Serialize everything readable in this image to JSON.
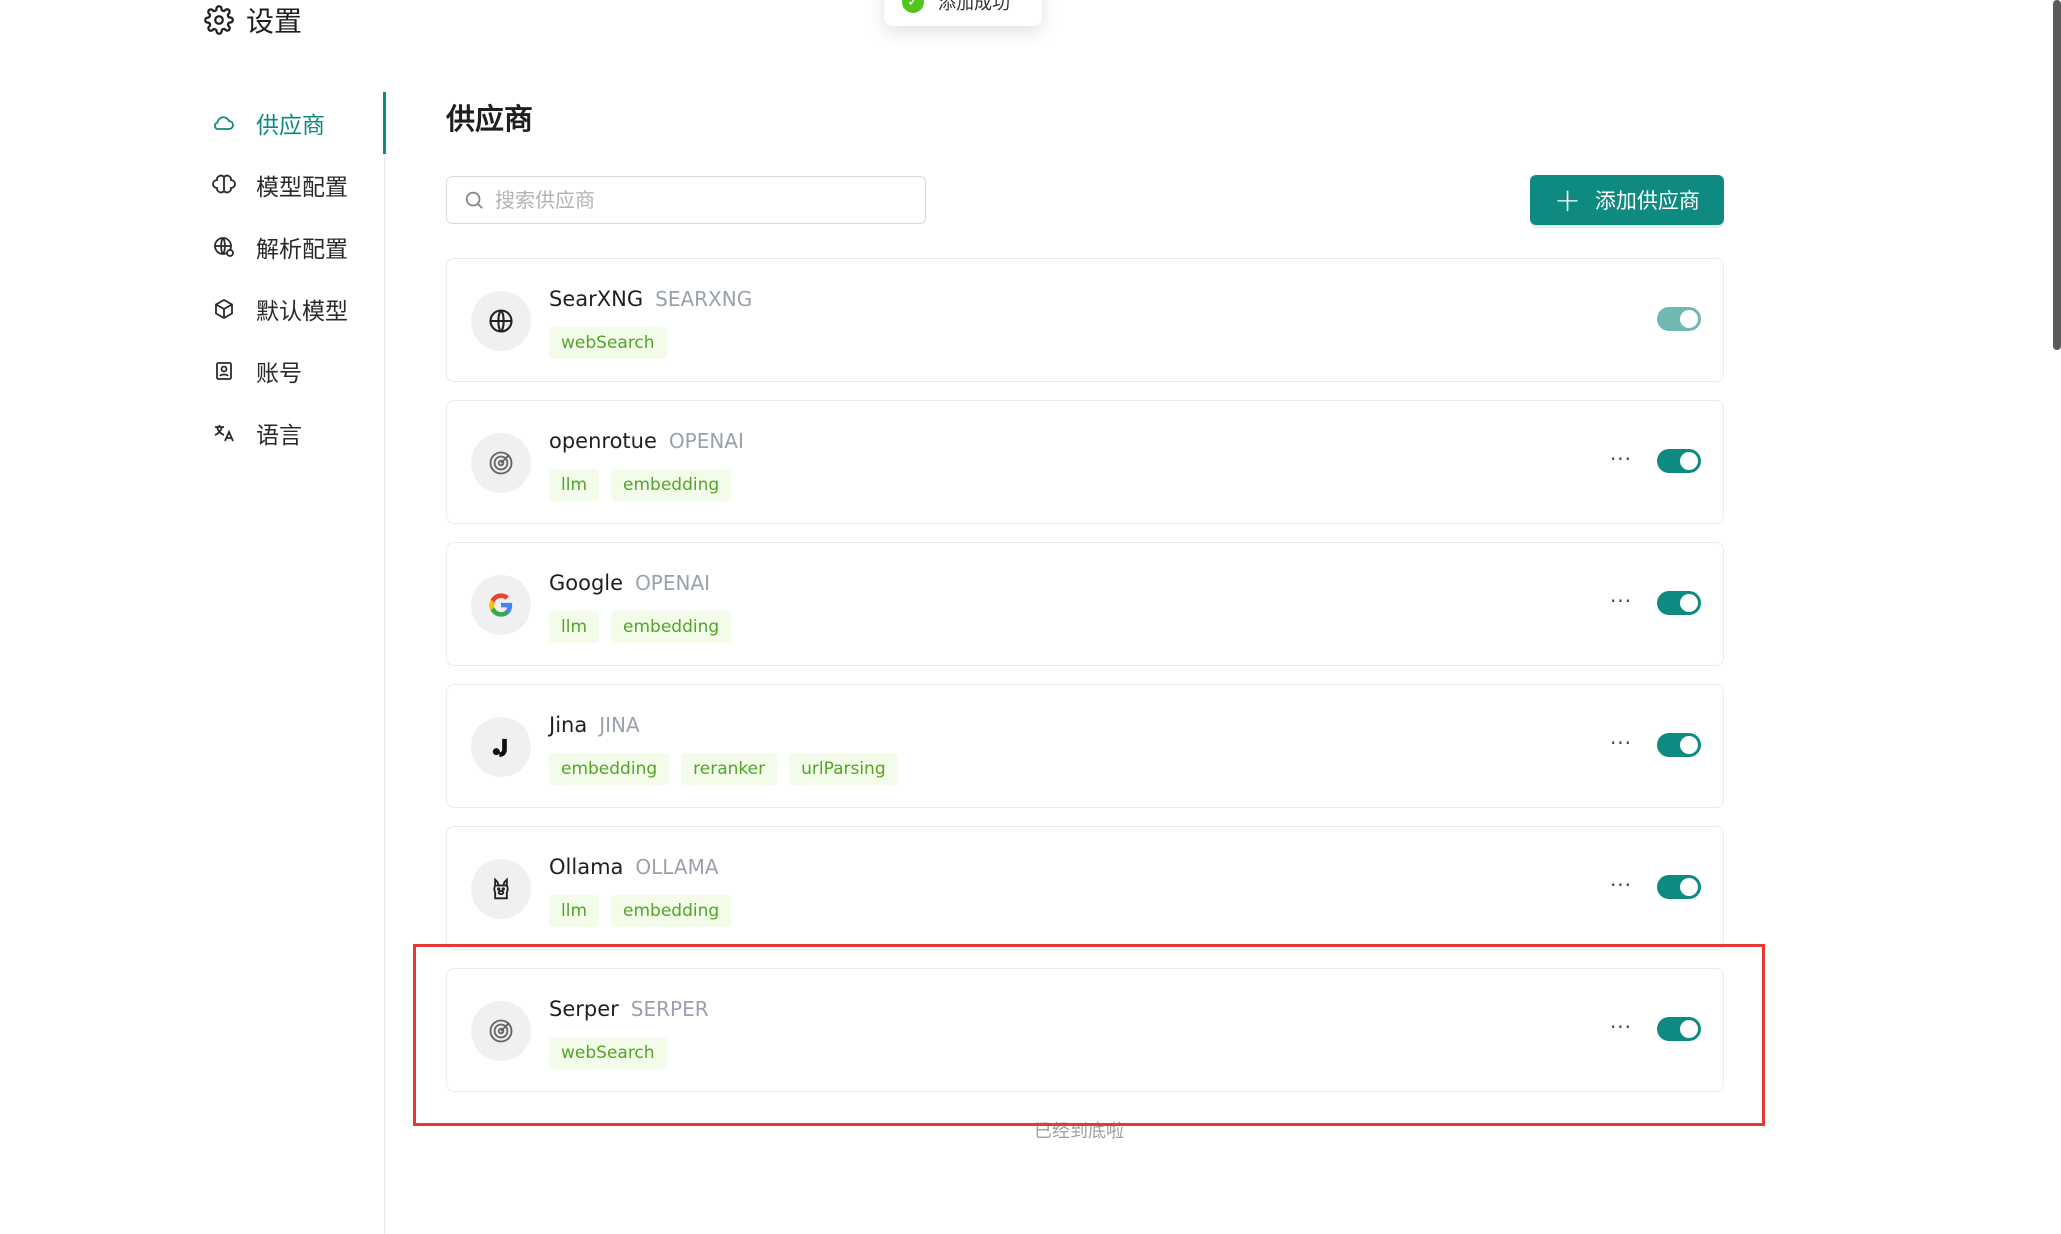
{
  "header": {
    "title": "设置"
  },
  "toast": {
    "message": "添加成功"
  },
  "sidebar": {
    "items": [
      {
        "label": "供应商",
        "icon": "cloud-icon",
        "active": true
      },
      {
        "label": "模型配置",
        "icon": "brain-icon"
      },
      {
        "label": "解析配置",
        "icon": "globe-gear-icon"
      },
      {
        "label": "默认模型",
        "icon": "cube-icon"
      },
      {
        "label": "账号",
        "icon": "id-card-icon"
      },
      {
        "label": "语言",
        "icon": "translate-icon"
      }
    ]
  },
  "main": {
    "title": "供应商",
    "search": {
      "placeholder": "搜索供应商",
      "value": ""
    },
    "add_button": {
      "label": "添加供应商"
    },
    "providers": [
      {
        "name": "SearXNG",
        "type": "SEARXNG",
        "tags": [
          "webSearch"
        ],
        "icon": "globe-icon",
        "has_menu": false,
        "enabled": true,
        "toggle_disabled": true
      },
      {
        "name": "openrotue",
        "type": "OPENAI",
        "tags": [
          "llm",
          "embedding"
        ],
        "icon": "radar-icon",
        "has_menu": true,
        "enabled": true
      },
      {
        "name": "Google",
        "type": "OPENAI",
        "tags": [
          "llm",
          "embedding"
        ],
        "icon": "google-icon",
        "has_menu": true,
        "enabled": true
      },
      {
        "name": "Jina",
        "type": "JINA",
        "tags": [
          "embedding",
          "reranker",
          "urlParsing"
        ],
        "icon": "jina-icon",
        "has_menu": true,
        "enabled": true
      },
      {
        "name": "Ollama",
        "type": "OLLAMA",
        "tags": [
          "llm",
          "embedding"
        ],
        "icon": "llama-icon",
        "has_menu": true,
        "enabled": true
      },
      {
        "name": "Serper",
        "type": "SERPER",
        "tags": [
          "webSearch"
        ],
        "icon": "radar-icon",
        "has_menu": true,
        "enabled": true
      }
    ],
    "more_label": "···",
    "end_text": "已经到底啦"
  },
  "colors": {
    "accent": "#0e8a80",
    "tag_text": "#52a52a",
    "tag_bg": "#f3fbe9",
    "highlight": "#e53935"
  }
}
